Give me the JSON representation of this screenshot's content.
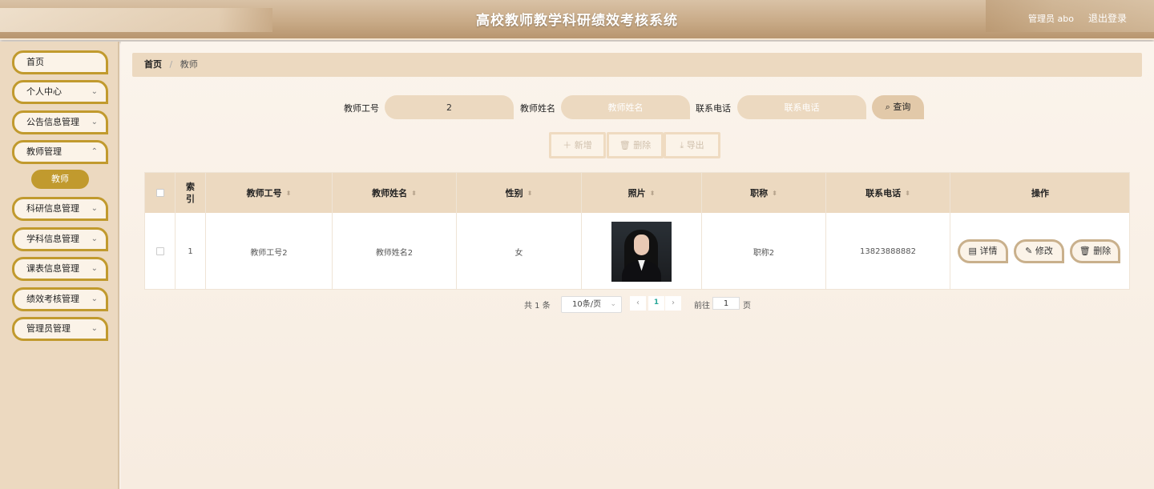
{
  "header": {
    "title": "高校教师教学科研绩效考核系统",
    "user_label": "管理员 abo",
    "logout_label": "退出登录"
  },
  "sidebar": {
    "items": [
      {
        "label": "首页",
        "has_arrow": false
      },
      {
        "label": "个人中心",
        "has_arrow": true
      },
      {
        "label": "公告信息管理",
        "has_arrow": true
      },
      {
        "label": "教师管理",
        "has_arrow": true
      },
      {
        "label": "科研信息管理",
        "has_arrow": true
      },
      {
        "label": "学科信息管理",
        "has_arrow": true
      },
      {
        "label": "课表信息管理",
        "has_arrow": true
      },
      {
        "label": "绩效考核管理",
        "has_arrow": true
      },
      {
        "label": "管理员管理",
        "has_arrow": true
      }
    ],
    "active_sub": "教师"
  },
  "breadcrumb": {
    "home": "首页",
    "current": "教师"
  },
  "search": {
    "id_label": "教师工号",
    "id_value": "2",
    "name_label": "教师姓名",
    "name_placeholder": "教师姓名",
    "phone_label": "联系电话",
    "phone_placeholder": "联系电话",
    "query_label": "查询"
  },
  "actions": {
    "add": "新增",
    "delete": "删除",
    "export": "导出"
  },
  "table": {
    "headers": [
      "索引",
      "教师工号",
      "教师姓名",
      "性别",
      "照片",
      "职称",
      "联系电话",
      "操作"
    ],
    "rows": [
      {
        "index": "1",
        "teacher_id": "教师工号2",
        "name": "教师姓名2",
        "gender": "女",
        "title": "职称2",
        "phone": "13823888882"
      }
    ],
    "row_actions": {
      "detail": "详情",
      "edit": "修改",
      "delete": "删除"
    }
  },
  "pagination": {
    "total_prefix": "共 1 条",
    "page_size": "10条/页",
    "current_page": "1",
    "goto_label": "前往",
    "goto_value": "1",
    "page_suffix": "页"
  },
  "colors": {
    "accent": "#c19a2e",
    "panel": "#ecd9c0",
    "header": "#c9ab88"
  }
}
